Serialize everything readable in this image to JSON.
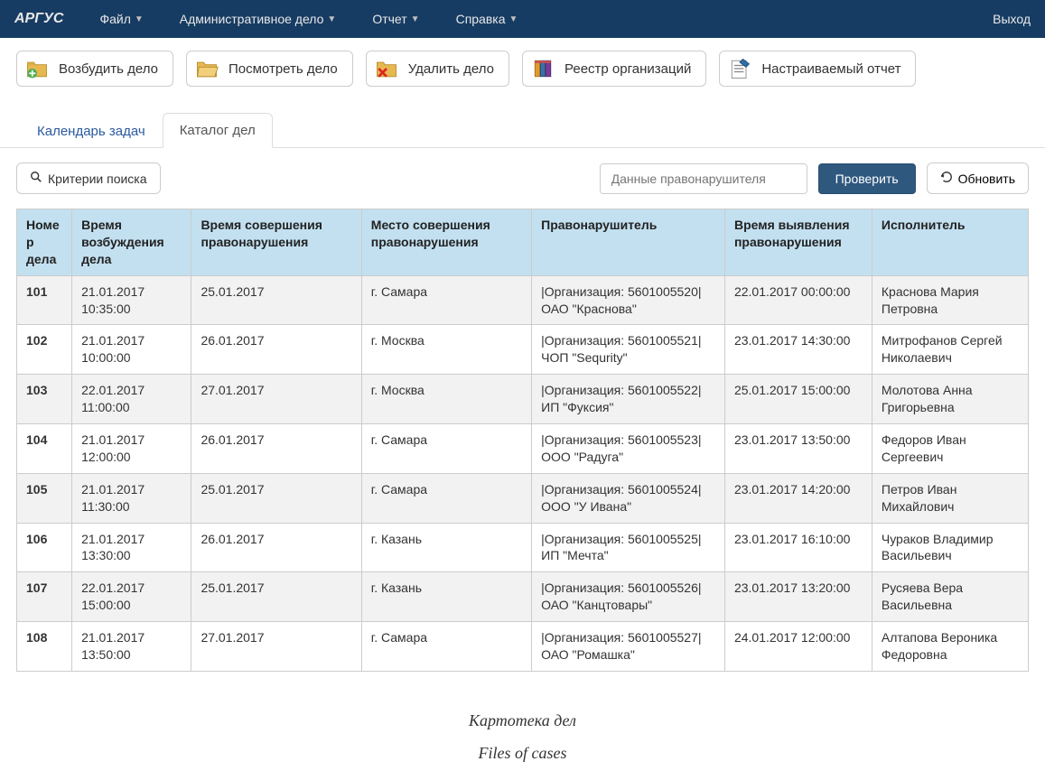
{
  "navbar": {
    "brand": "АРГУС",
    "items": [
      {
        "label": "Файл"
      },
      {
        "label": "Административное дело"
      },
      {
        "label": "Отчет"
      },
      {
        "label": "Справка"
      }
    ],
    "exit": "Выход"
  },
  "toolbar": {
    "create_case": "Возбудить дело",
    "view_case": "Посмотреть дело",
    "delete_case": "Удалить дело",
    "org_registry": "Реестр организаций",
    "config_report": "Настраиваемый отчет"
  },
  "tabs": {
    "calendar": "Календарь задач",
    "catalog": "Каталог дел"
  },
  "actions": {
    "criteria": "Критерии поиска",
    "offender_placeholder": "Данные правонарушителя",
    "check": "Проверить",
    "refresh": "Обновить"
  },
  "table": {
    "headers": {
      "num": "Номер дела",
      "init_time": "Время возбуждения дела",
      "offense_time": "Время совершения правонарушения",
      "offense_place": "Место совершения правонарушения",
      "offender": "Правонарушитель",
      "detect_time": "Время выявления правонарушения",
      "executor": "Исполнитель"
    },
    "rows": [
      {
        "num": "101",
        "init_time": "21.01.2017 10:35:00",
        "offense_time": "25.01.2017",
        "offense_place": "г. Самара",
        "offender": "|Организация: 5601005520| ОАО \"Краснова\"",
        "detect_time": "22.01.2017 00:00:00",
        "executor": "Краснова Мария Петровна"
      },
      {
        "num": "102",
        "init_time": "21.01.2017 10:00:00",
        "offense_time": "26.01.2017",
        "offense_place": "г. Москва",
        "offender": "|Организация: 5601005521| ЧОП \"Sequrity\"",
        "detect_time": "23.01.2017 14:30:00",
        "executor": "Митрофанов Сергей Николаевич"
      },
      {
        "num": "103",
        "init_time": "22.01.2017 11:00:00",
        "offense_time": "27.01.2017",
        "offense_place": "г. Москва",
        "offender": "|Организация: 5601005522| ИП \"Фуксия\"",
        "detect_time": "25.01.2017 15:00:00",
        "executor": "Молотова Анна Григорьевна"
      },
      {
        "num": "104",
        "init_time": "21.01.2017 12:00:00",
        "offense_time": "26.01.2017",
        "offense_place": "г. Самара",
        "offender": "|Организация: 5601005523| ООО \"Радуга\"",
        "detect_time": "23.01.2017 13:50:00",
        "executor": "Федоров Иван Сергеевич"
      },
      {
        "num": "105",
        "init_time": "21.01.2017 11:30:00",
        "offense_time": "25.01.2017",
        "offense_place": "г. Самара",
        "offender": "|Организация: 5601005524| ООО \"У Ивана\"",
        "detect_time": "23.01.2017 14:20:00",
        "executor": "Петров Иван Михайлович"
      },
      {
        "num": "106",
        "init_time": "21.01.2017 13:30:00",
        "offense_time": "26.01.2017",
        "offense_place": "г. Казань",
        "offender": "|Организация: 5601005525| ИП \"Мечта\"",
        "detect_time": "23.01.2017 16:10:00",
        "executor": "Чураков Владимир Васильевич"
      },
      {
        "num": "107",
        "init_time": "22.01.2017 15:00:00",
        "offense_time": "25.01.2017",
        "offense_place": "г. Казань",
        "offender": "|Организация: 5601005526| ОАО \"Канцтовары\"",
        "detect_time": "23.01.2017 13:20:00",
        "executor": "Русяева Вера Васильевна"
      },
      {
        "num": "108",
        "init_time": "21.01.2017 13:50:00",
        "offense_time": "27.01.2017",
        "offense_place": "г. Самара",
        "offender": "|Организация: 5601005527| ОАО \"Ромашка\"",
        "detect_time": "24.01.2017 12:00:00",
        "executor": "Алтапова Вероника Федоровна"
      }
    ]
  },
  "captions": {
    "ru": "Картотека дел",
    "en": "Files of cases"
  }
}
